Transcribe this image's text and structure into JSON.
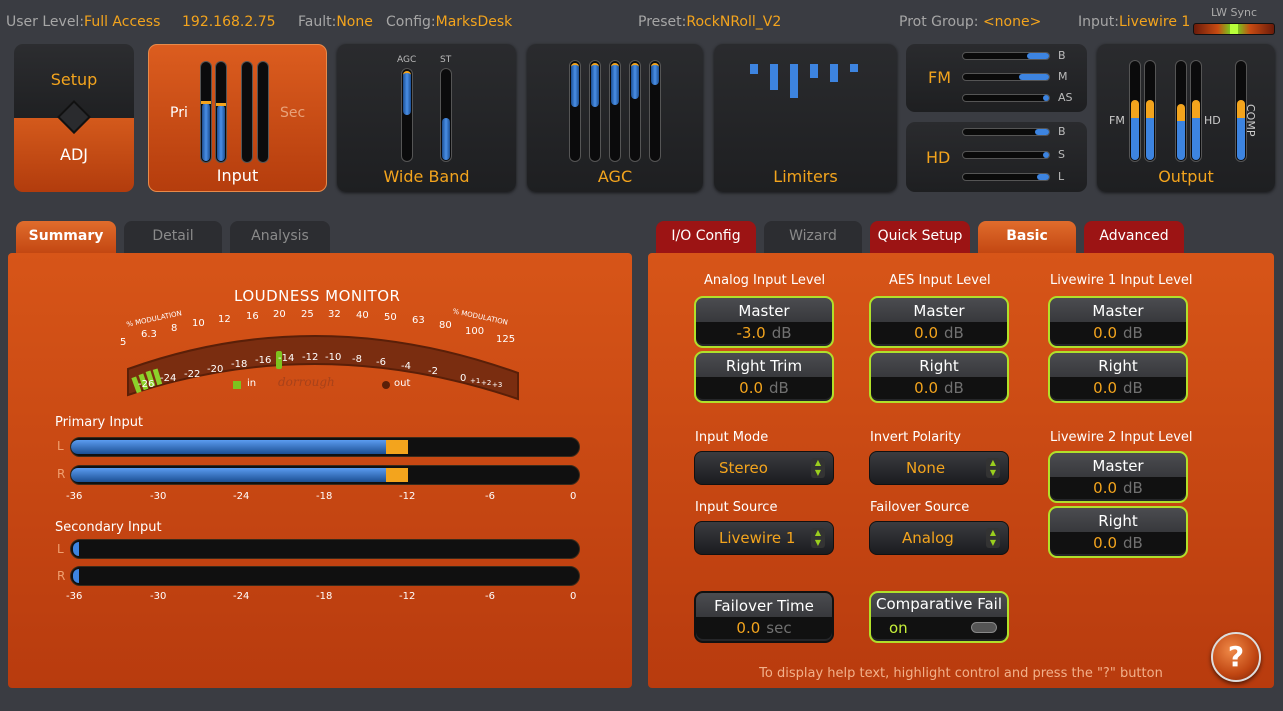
{
  "header": {
    "user_level_label": "User Level:",
    "user_level": "Full Access",
    "ip": "192.168.2.75",
    "fault_label": "Fault:",
    "fault": "None",
    "config_label": "Config:",
    "config": "MarksDesk",
    "preset_label": "Preset:",
    "preset": "RockNRoll_V2",
    "prot_label": "Prot Group:",
    "prot": "<none>",
    "input_label": "Input:",
    "input": "Livewire 1",
    "lw_sync": "LW Sync"
  },
  "modules": {
    "setup": "Setup",
    "adj": "ADJ",
    "input": "Input",
    "pri": "Pri",
    "sec": "Sec",
    "wideband": "Wide Band",
    "agc_label": "AGC",
    "st_label": "ST",
    "agc": "AGC",
    "limiters": "Limiters",
    "fm": "FM",
    "hd": "HD",
    "fm_bands": [
      "B",
      "M",
      "AS"
    ],
    "hd_bands": [
      "B",
      "S",
      "L"
    ],
    "output": "Output",
    "out_fm": "FM",
    "out_hd": "HD",
    "comp": "COMP"
  },
  "left_tabs": {
    "summary": "Summary",
    "detail": "Detail",
    "analysis": "Analysis"
  },
  "loudness": {
    "title": "LOUDNESS MONITOR",
    "mod_left": "% MODULATION",
    "mod_right": "% MODULATION",
    "mod_ticks": [
      "5",
      "6.3",
      "8",
      "10",
      "12",
      "16",
      "20",
      "25",
      "32",
      "40",
      "50",
      "63",
      "80",
      "100",
      "125"
    ],
    "db_ticks": [
      "-26",
      "-24",
      "-22",
      "-20",
      "-18",
      "-16",
      "-14",
      "-12",
      "-10",
      "-8",
      "-6",
      "-4",
      "-2",
      "0",
      "+1",
      "+2",
      "+3"
    ],
    "in": "in",
    "out": "out",
    "brand": "dorrough"
  },
  "primary": {
    "title": "Primary Input",
    "L": "L",
    "R": "R",
    "level_l": 0.62,
    "level_r": 0.62
  },
  "secondary": {
    "title": "Secondary Input",
    "L": "L",
    "R": "R"
  },
  "scale": [
    "-36",
    "-30",
    "-24",
    "-18",
    "-12",
    "-6",
    "0"
  ],
  "right_tabs": {
    "io": "I/O Config",
    "wizard": "Wizard",
    "quick": "Quick Setup",
    "basic": "Basic",
    "advanced": "Advanced"
  },
  "analog": {
    "title": "Analog Input Level",
    "master": "Master",
    "master_val": "-3.0",
    "trim": "Right Trim",
    "trim_val": "0.0",
    "unit": "dB"
  },
  "aes": {
    "title": "AES Input Level",
    "master": "Master",
    "master_val": "0.0",
    "right": "Right",
    "right_val": "0.0",
    "unit": "dB"
  },
  "lw1": {
    "title": "Livewire 1 Input Level",
    "master": "Master",
    "master_val": "0.0",
    "right": "Right",
    "right_val": "0.0",
    "unit": "dB"
  },
  "lw2": {
    "title": "Livewire 2 Input Level",
    "master": "Master",
    "master_val": "0.0",
    "right": "Right",
    "right_val": "0.0",
    "unit": "dB"
  },
  "input_mode": {
    "label": "Input Mode",
    "value": "Stereo"
  },
  "invert": {
    "label": "Invert Polarity",
    "value": "None"
  },
  "input_source": {
    "label": "Input Source",
    "value": "Livewire 1"
  },
  "failover_source": {
    "label": "Failover Source",
    "value": "Analog"
  },
  "failover_time": {
    "label": "Failover Time",
    "value": "0.0",
    "unit": "sec"
  },
  "comparative": {
    "label": "Comparative Fail",
    "value": "on"
  },
  "help": {
    "text": "To display help text, highlight control and press the \"?\" button",
    "button": "?"
  }
}
